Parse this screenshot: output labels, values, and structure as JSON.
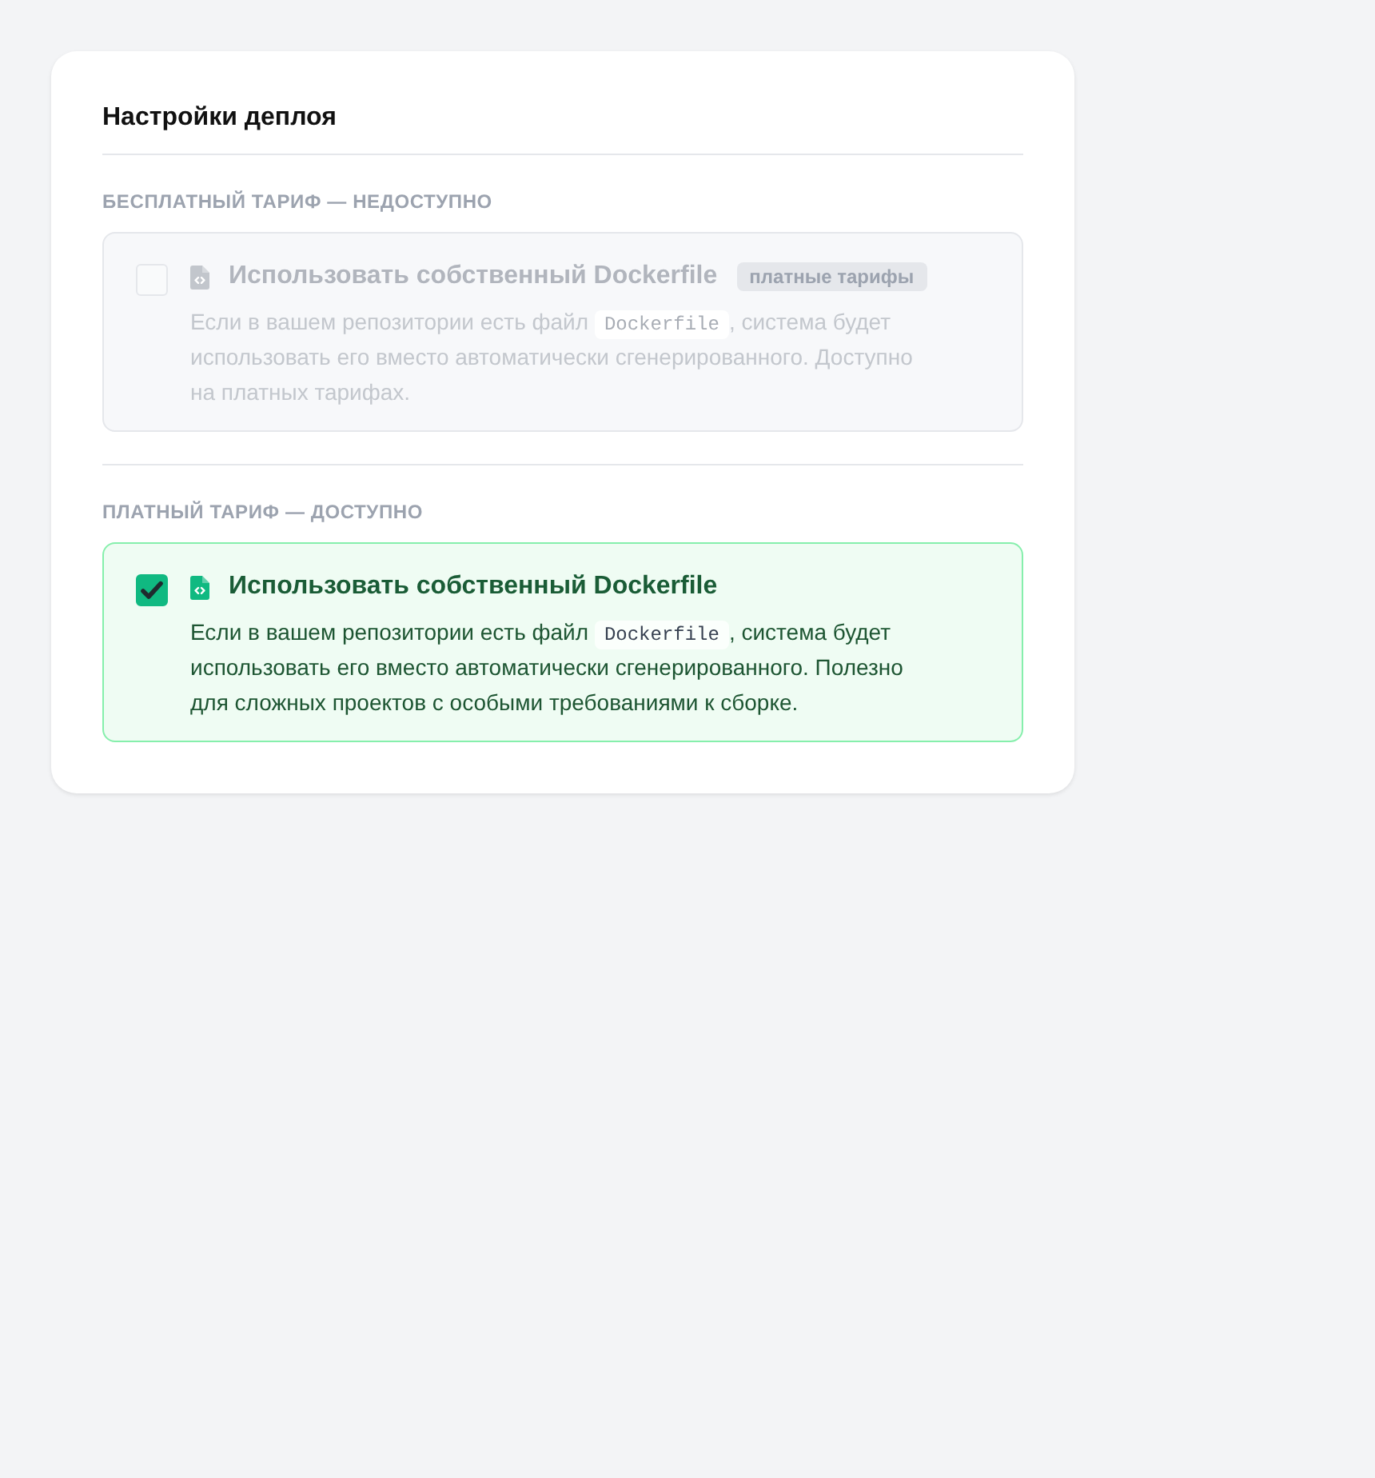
{
  "title": "Настройки деплоя",
  "sections": [
    {
      "label": "БЕСПЛАТНЫЙ ТАРИФ — НЕДОСТУПНО",
      "option": {
        "title": "Использовать собственный Dockerfile",
        "badge": "платные тарифы",
        "disabled": true,
        "checked": false,
        "description": [
          {
            "kind": "text",
            "text": "Если в вашем репозитории есть файл "
          },
          {
            "kind": "code",
            "text": "Dockerfile"
          },
          {
            "kind": "text",
            "text": ", система будет использовать его вместо автоматически сгенерированного. Доступно на платных тарифах."
          }
        ]
      }
    },
    {
      "label": "ПЛАТНЫЙ ТАРИФ — ДОСТУПНО",
      "option": {
        "title": "Использовать собственный Dockerfile",
        "disabled": false,
        "checked": true,
        "description": [
          {
            "kind": "text",
            "text": "Если в вашем репозитории есть файл "
          },
          {
            "kind": "code",
            "text": "Dockerfile"
          },
          {
            "kind": "text",
            "text": ", система будет использовать его вместо автоматически сгенерированного. Полезно для сложных проектов с особыми требованиями к сборке."
          }
        ]
      }
    }
  ]
}
